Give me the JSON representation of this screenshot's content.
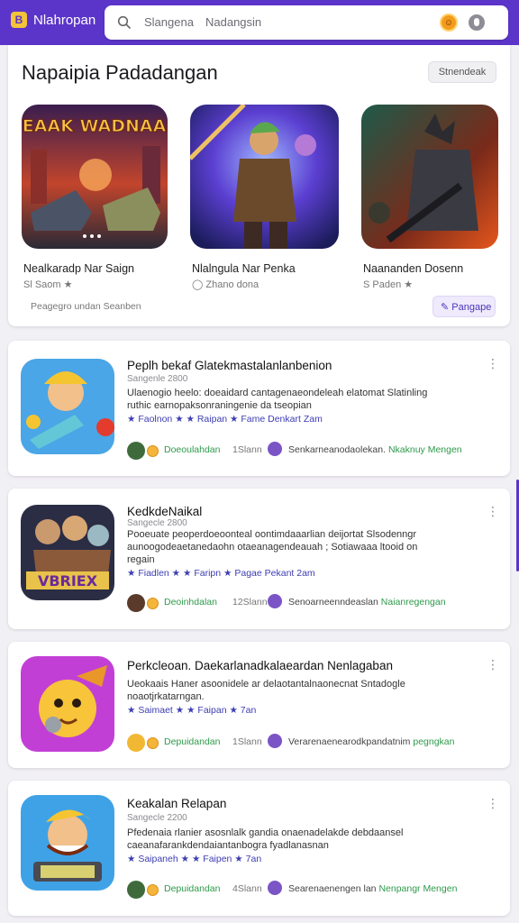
{
  "app": {
    "name": "Nlahropan"
  },
  "search": {
    "query_a": "Slangena",
    "query_b": "Nadangsin"
  },
  "featured": {
    "title": "Napaipia Padadangan",
    "button": "Stnendeak",
    "footer": "Peagegro undan Seanben",
    "action": "Pangape",
    "items": [
      {
        "banner": "YEAAK WADNAAK",
        "name": "Nealkaradp Nar Saign",
        "meta": "Sl Saom ★"
      },
      {
        "banner": "",
        "name": "Nlalngula Nar Penka",
        "meta": "◯ Zhano dona"
      },
      {
        "banner": "",
        "name": "Naananden Dosenn",
        "meta": "S Paden ★"
      }
    ]
  },
  "cards": [
    {
      "title": "Peplh bekaf Glatekmastalanlanbenion",
      "subtitle": "Sangenle 2800",
      "desc": "Ulaenogio heelo: doeaidard cantagenaeondeleah elatomat Slatinling ruthic earnopaksonraningenie da tseopian",
      "rating": "★ Faolnon ★ ★ Raipan ★ Fame Denkart Zam",
      "foot_a": "Doeoulahdan",
      "foot_b": "1Slann",
      "foot_d": "Senkarneanodaolekan.",
      "foot_d_green": "Nkaknuy Mengen"
    },
    {
      "title": "KedkdeNaikal",
      "subtitle": "Sangecle 2800",
      "desc": "Pooeuate peoperdoeoonteal oontimdaaarlian deijortat Slsodenngr aunoogodeaetanedaohn otaeanagendeauah ; Sotiawaaa ltooid on regain",
      "rating": "★ Fiadlen ★ ★ Faripn ★ Pagae Pekant 2am",
      "foot_a": "Deoinhdalan",
      "foot_b": "12Slann",
      "foot_d": "Senoarneenndeaslan",
      "foot_d_green": "Naianregengan"
    },
    {
      "title": "Perkcleoan. Daekarlanadkalaeardan Nenlagaban",
      "subtitle": "",
      "desc": "Ueokaais Haner asoonidele ar delaotantalnaonecnat Sntadogle noaotjrkatarngan.",
      "rating": "★ Saimaet ★ ★ Faipan ★ 7an",
      "foot_a": "Depuidandan",
      "foot_b": "1Slann",
      "foot_d": "Verarenaenearodkpandatnim",
      "foot_d_green": "pegngkan"
    },
    {
      "title": "Keakalan Relapan",
      "subtitle": "Sangecle 2200",
      "desc": "Pfedenaia rlanier asosnlalk gandia onaenadelakde debdaansel caeanafarankdendaiantanbogra fyadlanasnan",
      "rating": "★ Saipaneh ★ ★ Faipen ★ 7an",
      "foot_a": "Depuidandan",
      "foot_b": "4Slann",
      "foot_d": "Searenaenengen lan",
      "foot_d_green": "Nenpangr Mengen"
    }
  ],
  "colors": {
    "accent": "#5b35c9",
    "green": "#2e9a4b",
    "star": "#3d3db3"
  },
  "icons": [
    "search-icon",
    "mic-icon",
    "more-icon"
  ]
}
